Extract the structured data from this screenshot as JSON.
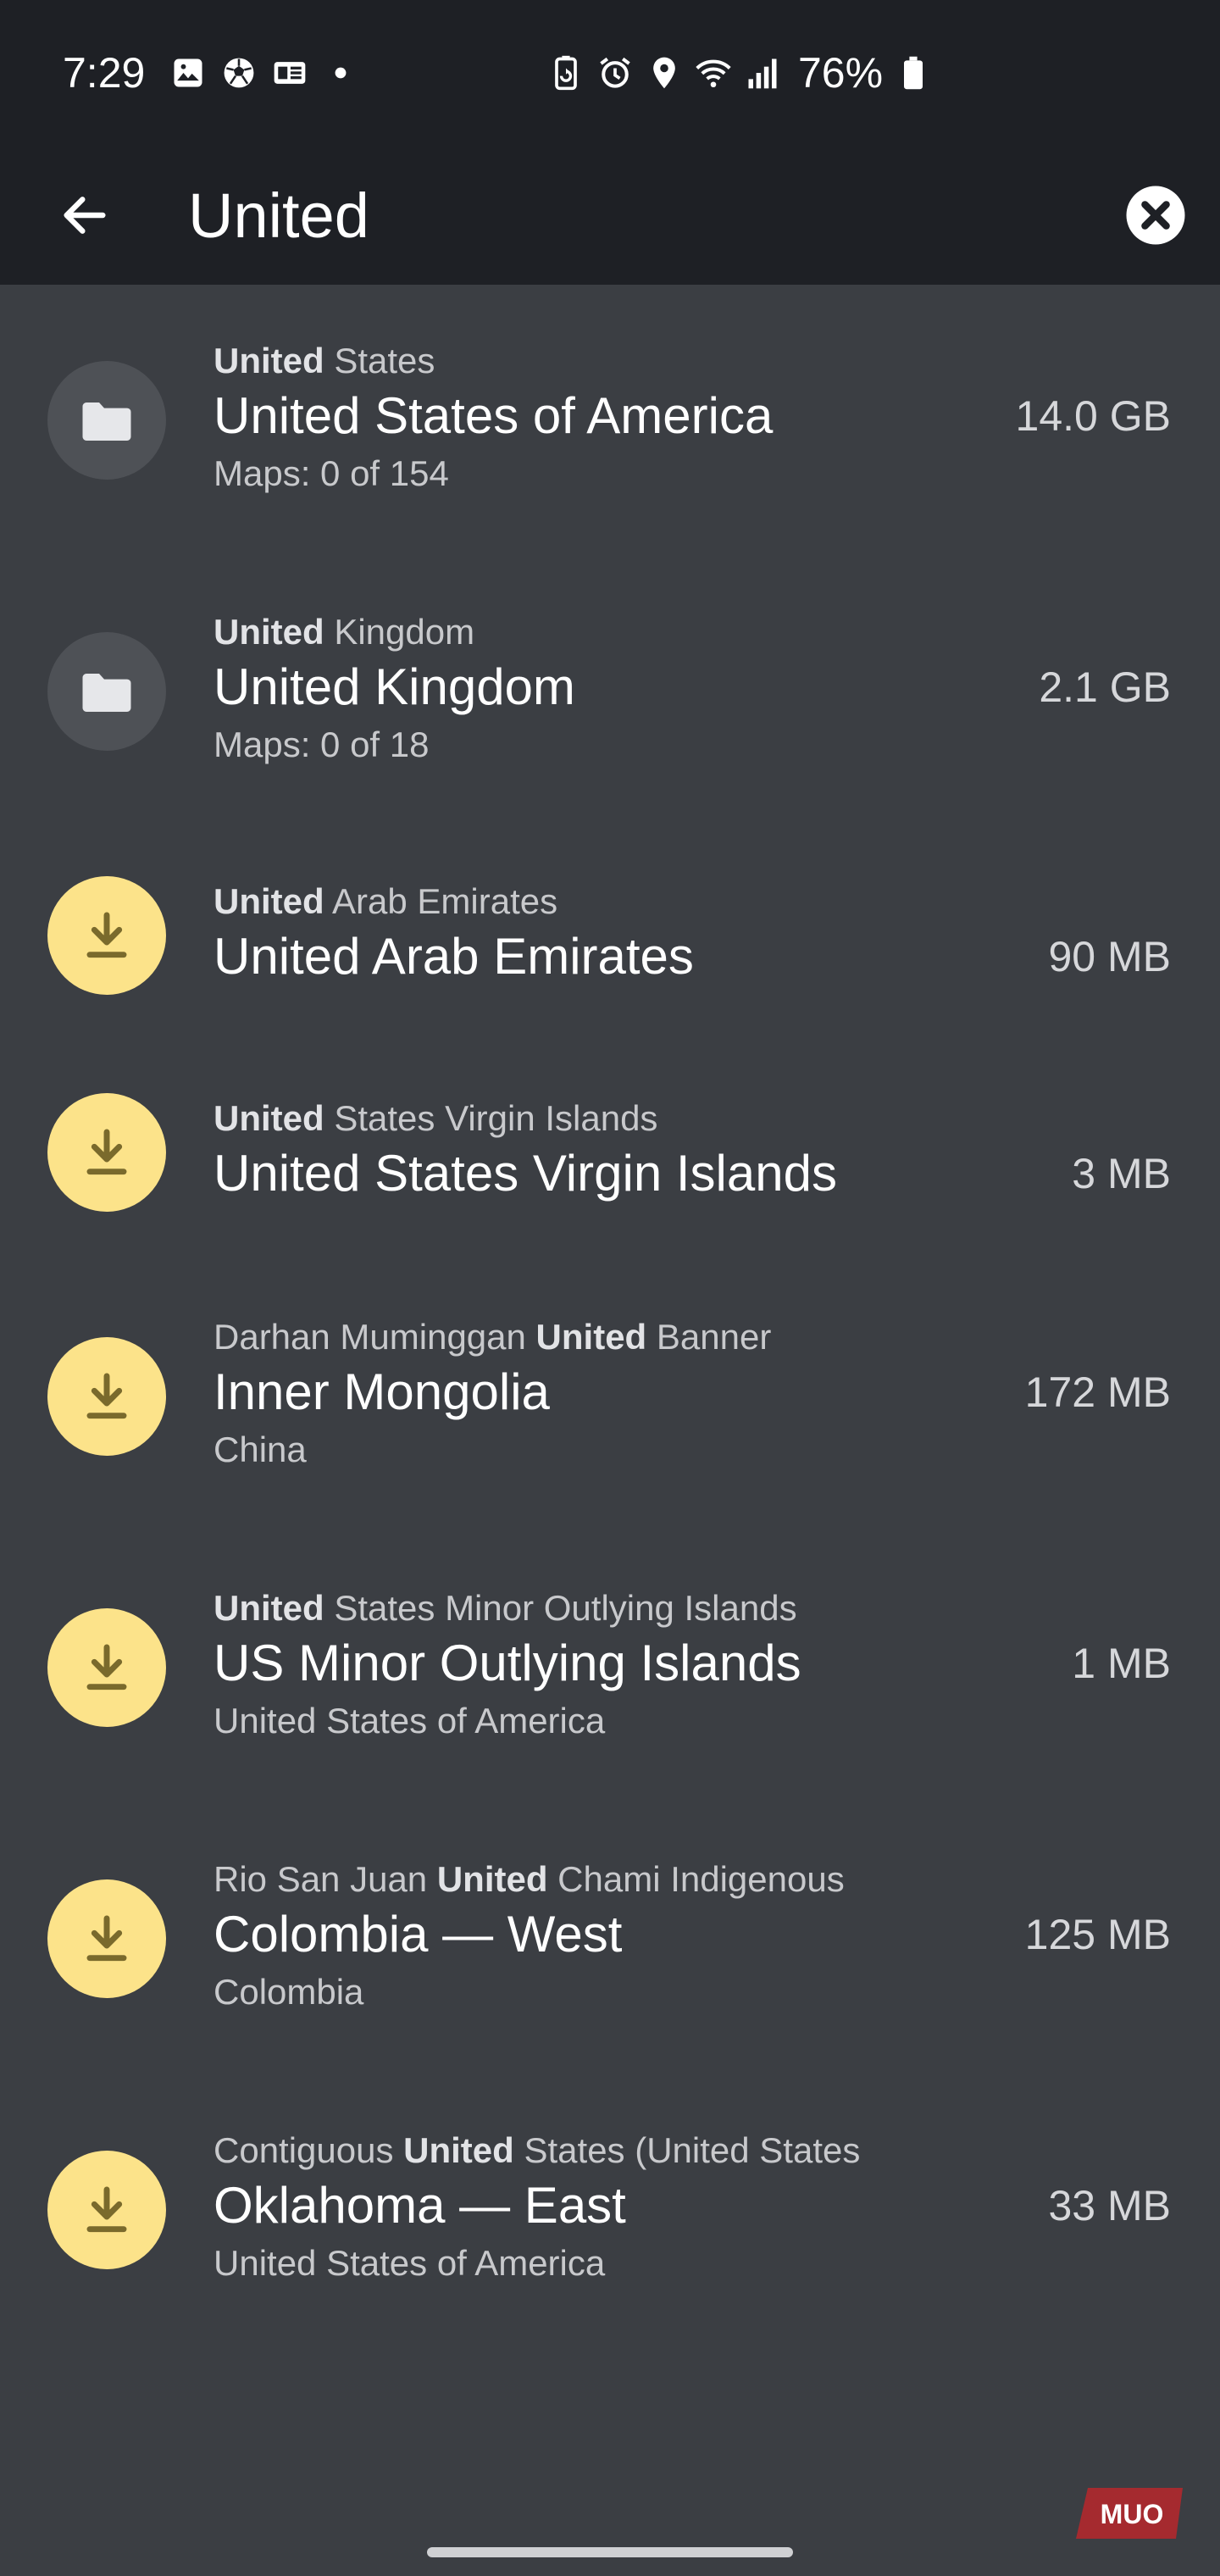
{
  "status_bar": {
    "time": "7:29",
    "battery_percent": "76%",
    "left_icons": [
      "gallery-icon",
      "soccer-ball-icon",
      "news-icon",
      "notification-dot-icon"
    ],
    "right_icons": [
      "recycle-battery-icon",
      "alarm-icon",
      "location-icon",
      "wifi-icon",
      "signal-icon",
      "battery-icon"
    ]
  },
  "search": {
    "query": "United",
    "back_icon": "arrow-left-icon",
    "clear_icon": "close-circle-icon"
  },
  "results": [
    {
      "path_before": "",
      "path_match": "United",
      "path_after": " States",
      "title": "United States of America",
      "subtitle": "Maps: 0 of 154",
      "size": "14.0 GB",
      "icon": "folder-icon"
    },
    {
      "path_before": "",
      "path_match": "United",
      "path_after": " Kingdom",
      "title": "United Kingdom",
      "subtitle": "Maps: 0 of 18",
      "size": "2.1 GB",
      "icon": "folder-icon"
    },
    {
      "path_before": "",
      "path_match": "United",
      "path_after": " Arab Emirates",
      "title": "United Arab Emirates",
      "subtitle": "",
      "size": "90 MB",
      "icon": "download-icon"
    },
    {
      "path_before": "",
      "path_match": "United",
      "path_after": " States Virgin Islands",
      "title": "United States Virgin Islands",
      "subtitle": "",
      "size": "3 MB",
      "icon": "download-icon"
    },
    {
      "path_before": "Darhan Muminggan ",
      "path_match": "United",
      "path_after": " Banner",
      "title": "Inner Mongolia",
      "subtitle": "China",
      "size": "172 MB",
      "icon": "download-icon"
    },
    {
      "path_before": "",
      "path_match": "United",
      "path_after": " States Minor Outlying Islands",
      "title": "US Minor Outlying Islands",
      "subtitle": "United States of America",
      "size": "1 MB",
      "icon": "download-icon"
    },
    {
      "path_before": "Rio San Juan ",
      "path_match": "United",
      "path_after": " Chami Indigenous",
      "title": "Colombia — West",
      "subtitle": "Colombia",
      "size": "125 MB",
      "icon": "download-icon"
    },
    {
      "path_before": "Contiguous ",
      "path_match": "United",
      "path_after": " States (United States",
      "title": "Oklahoma — East",
      "subtitle": "United States of America",
      "size": "33 MB",
      "icon": "download-icon"
    }
  ],
  "watermark": "MUO",
  "colors": {
    "background": "#3b3e43",
    "topbar": "#1e2025",
    "folder_circle": "#4e5156",
    "download_circle": "#fce38a",
    "download_glyph": "#7a6a2c"
  }
}
